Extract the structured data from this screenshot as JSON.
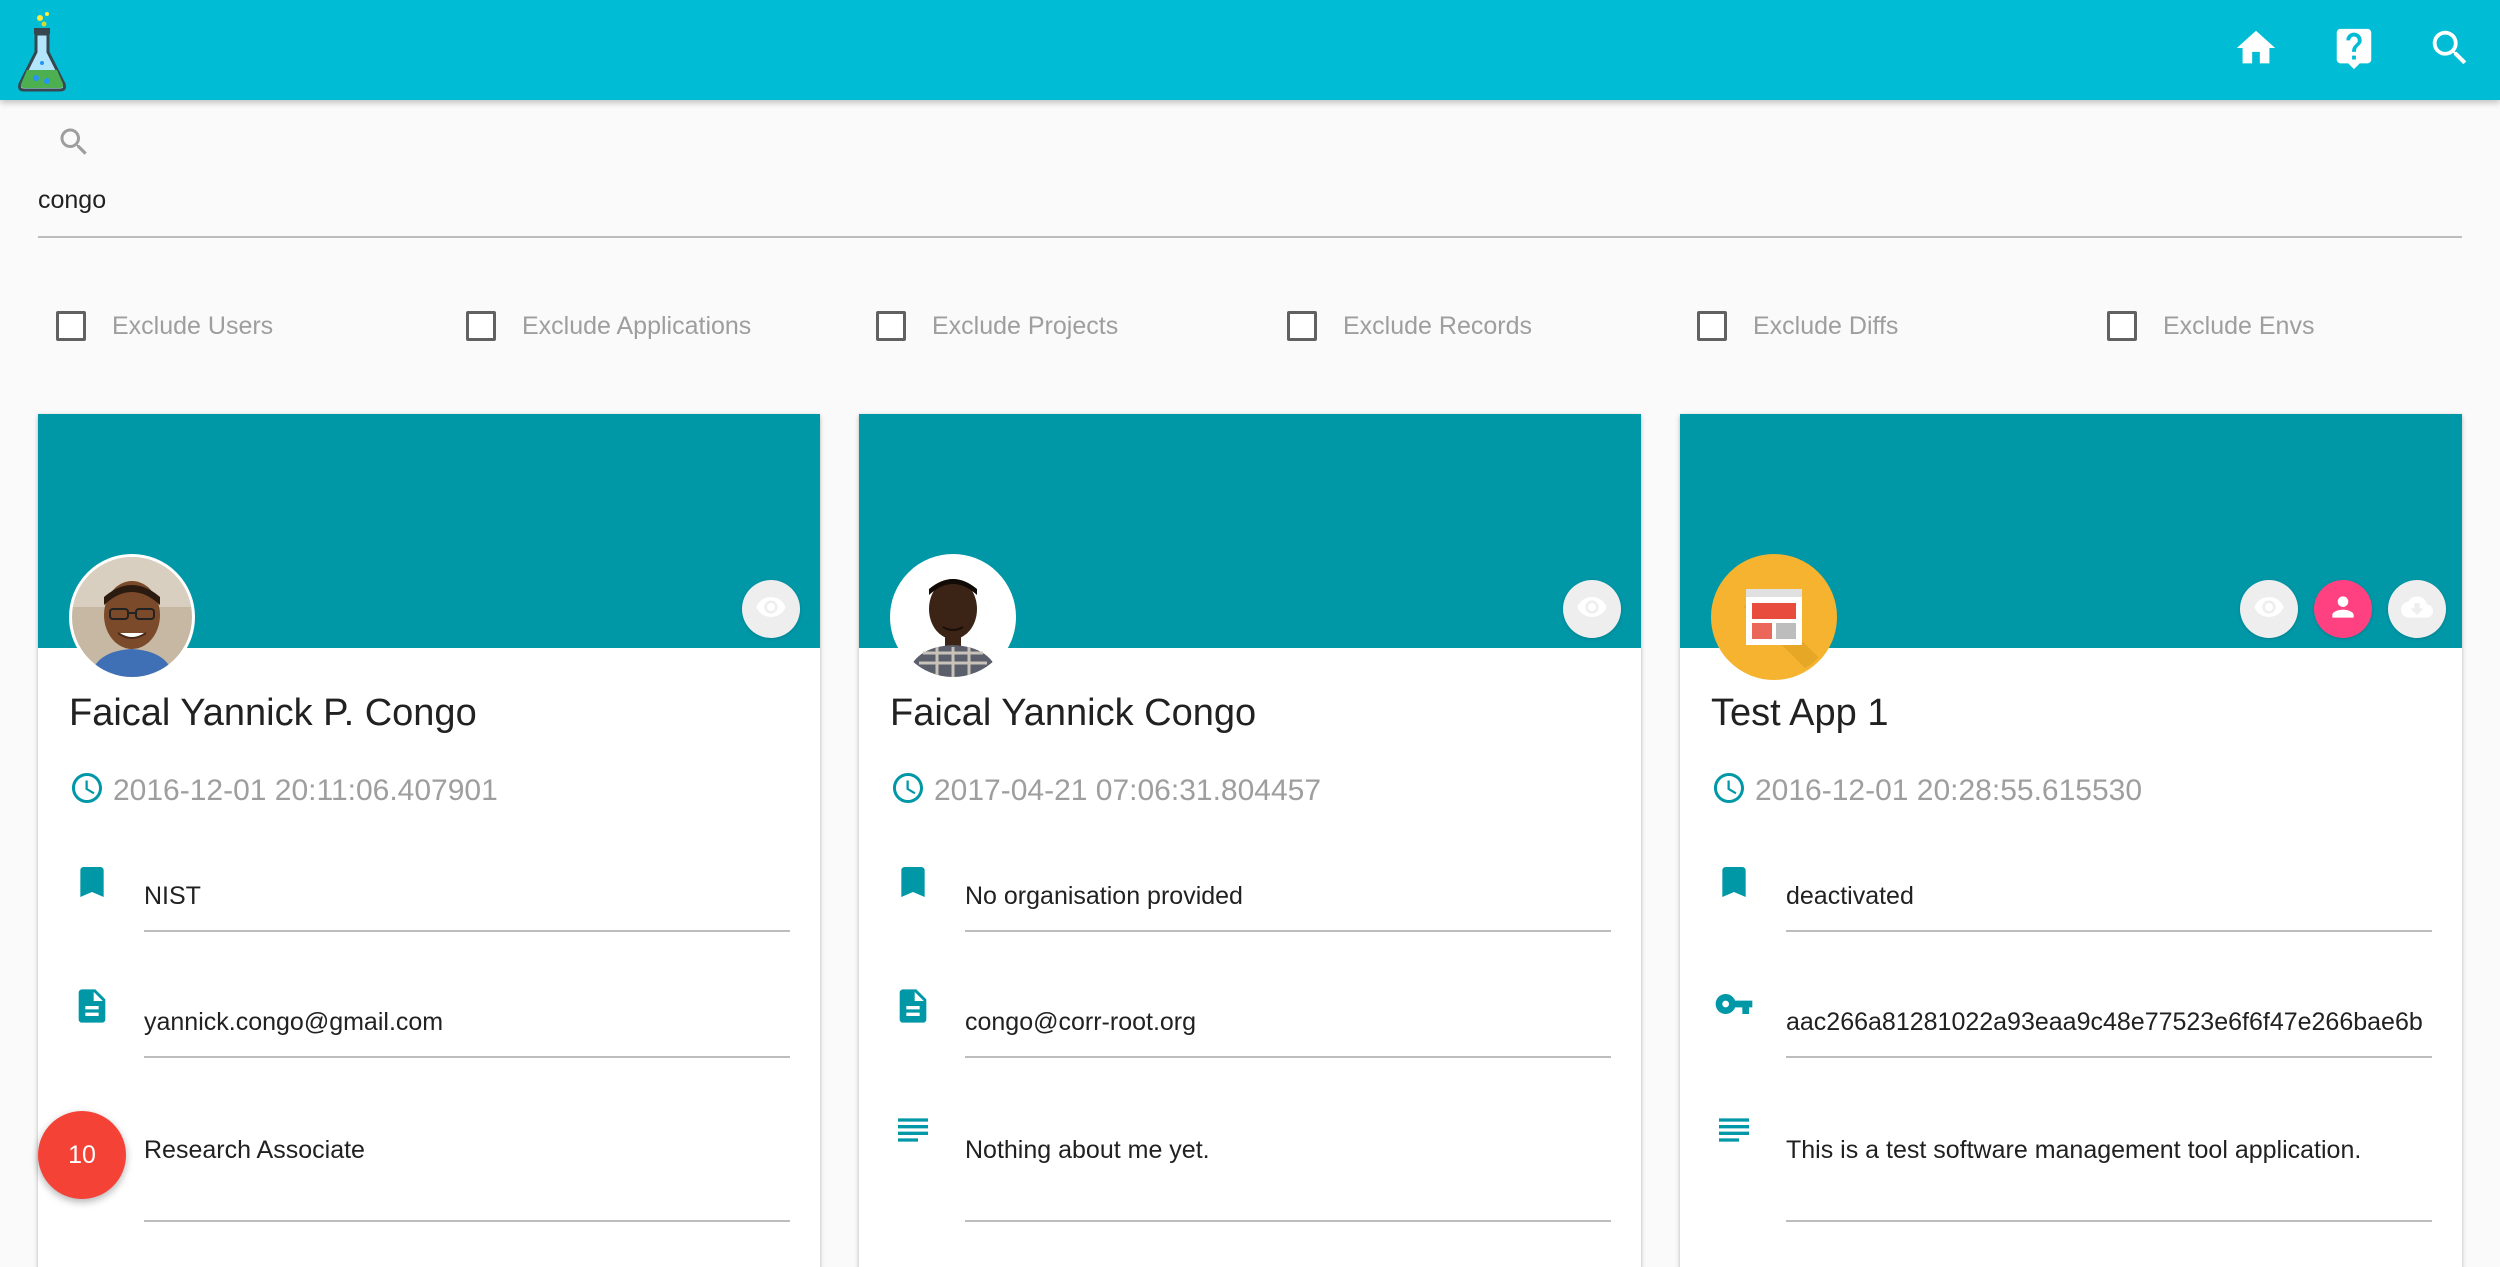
{
  "search": {
    "value": "congo"
  },
  "filters": [
    {
      "label": "Exclude Users",
      "checked": false
    },
    {
      "label": "Exclude Applications",
      "checked": false
    },
    {
      "label": "Exclude Projects",
      "checked": false
    },
    {
      "label": "Exclude Records",
      "checked": false
    },
    {
      "label": "Exclude Diffs",
      "checked": false
    },
    {
      "label": "Exclude Envs",
      "checked": false
    }
  ],
  "cards": [
    {
      "kind": "user",
      "name": "Faical Yannick P. Congo",
      "timestamp": "2016-12-01 20:11:06.407901",
      "organisation": "NIST",
      "email": "yannick.congo@gmail.com",
      "about": "Research Associate"
    },
    {
      "kind": "user",
      "name": "Faical Yannick Congo",
      "timestamp": "2017-04-21 07:06:31.804457",
      "organisation": "No organisation provided",
      "email": "congo@corr-root.org",
      "about": "Nothing about me yet."
    },
    {
      "kind": "application",
      "name": "Test App 1",
      "timestamp": "2016-12-01 20:28:55.615530",
      "status": "deactivated",
      "api_key": "aac266a81281022a93eaa9c48e77523e6f6f47e266bae6b",
      "description": "This is a test software management tool application."
    }
  ],
  "fab": {
    "count": "10"
  },
  "colors": {
    "appbar": "#00bcd4",
    "banner": "#0097a7",
    "accent": "#ff4081",
    "fab": "#f44336",
    "app_avatar": "#f5b32f"
  },
  "icons": {
    "appbar": [
      "home-icon",
      "help-icon",
      "search-icon"
    ],
    "card_actions": [
      "eye-icon",
      "account-icon",
      "download-icon"
    ],
    "fields": [
      "bookmark-icon",
      "document-icon",
      "key-icon",
      "notes-icon",
      "clock-icon"
    ]
  }
}
